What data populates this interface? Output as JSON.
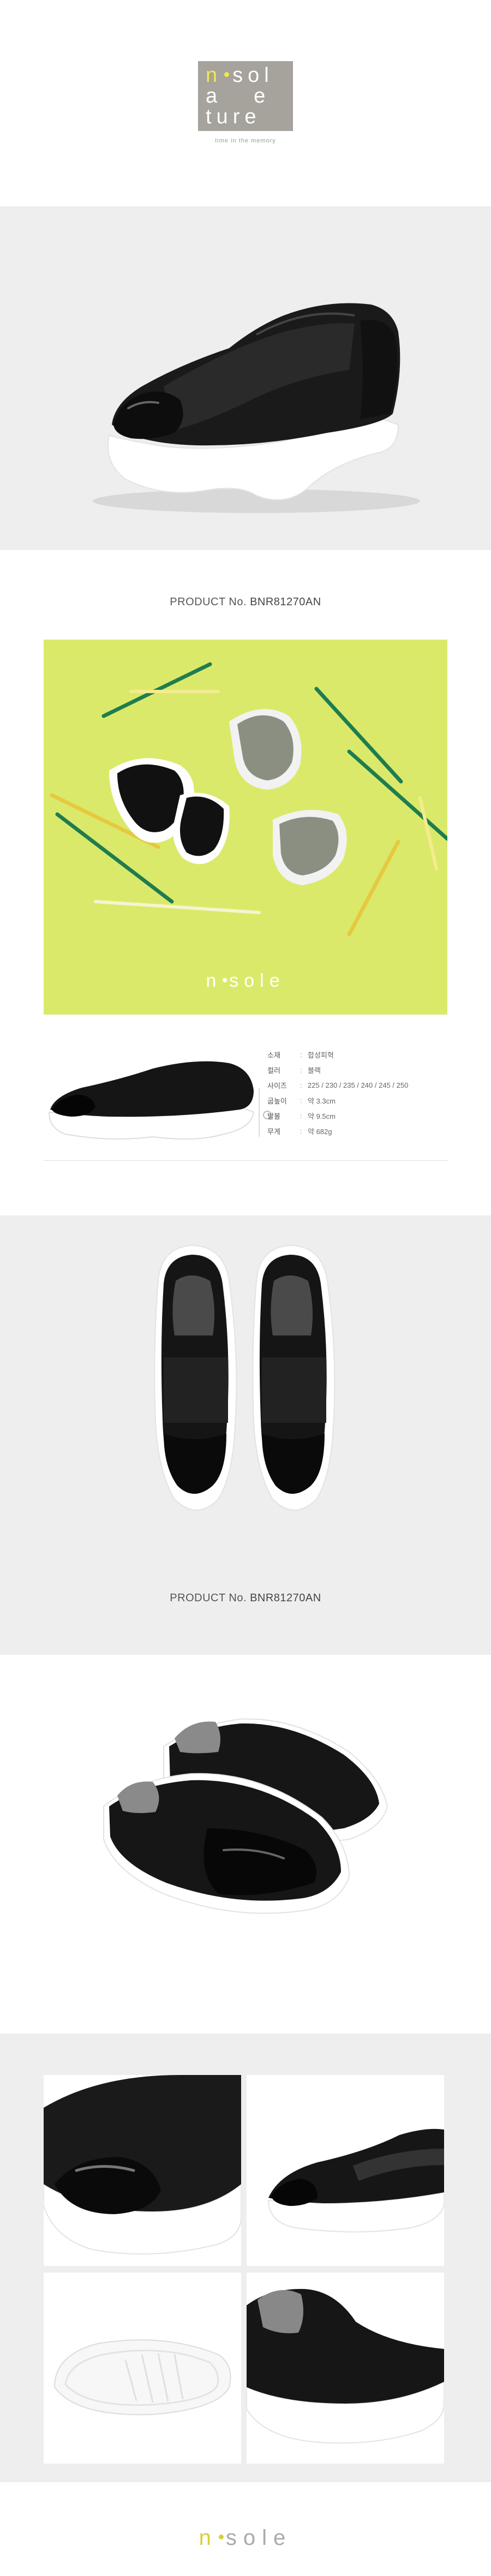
{
  "brand": {
    "logo_lines": [
      "sol",
      "a",
      "e",
      "ture"
    ],
    "logo_n": "n",
    "tagline": "time in the memory",
    "footer_wordmark": "sole",
    "footer_n": "n",
    "lifestyle_wordmark": "sole",
    "lifestyle_n": "n"
  },
  "product": {
    "label": "PRODUCT No.",
    "code": "BNR81270AN"
  },
  "specs": [
    {
      "label": "소재",
      "value": "합성피혁"
    },
    {
      "label": "컬러",
      "value": "블랙"
    },
    {
      "label": "사이즈",
      "value": "225 / 230 / 235 / 240 / 245 / 250"
    },
    {
      "label": "굽높이",
      "value": "약 3.3cm"
    },
    {
      "label": "발볼",
      "value": "약 9.5cm"
    },
    {
      "label": "무게",
      "value": "약 682g"
    }
  ],
  "colors": {
    "lifestyle_bg": "#dbe96a",
    "panel_bg": "#eeeeee",
    "logo_bg": "#a5a39c",
    "accent": "#f1e74d"
  }
}
